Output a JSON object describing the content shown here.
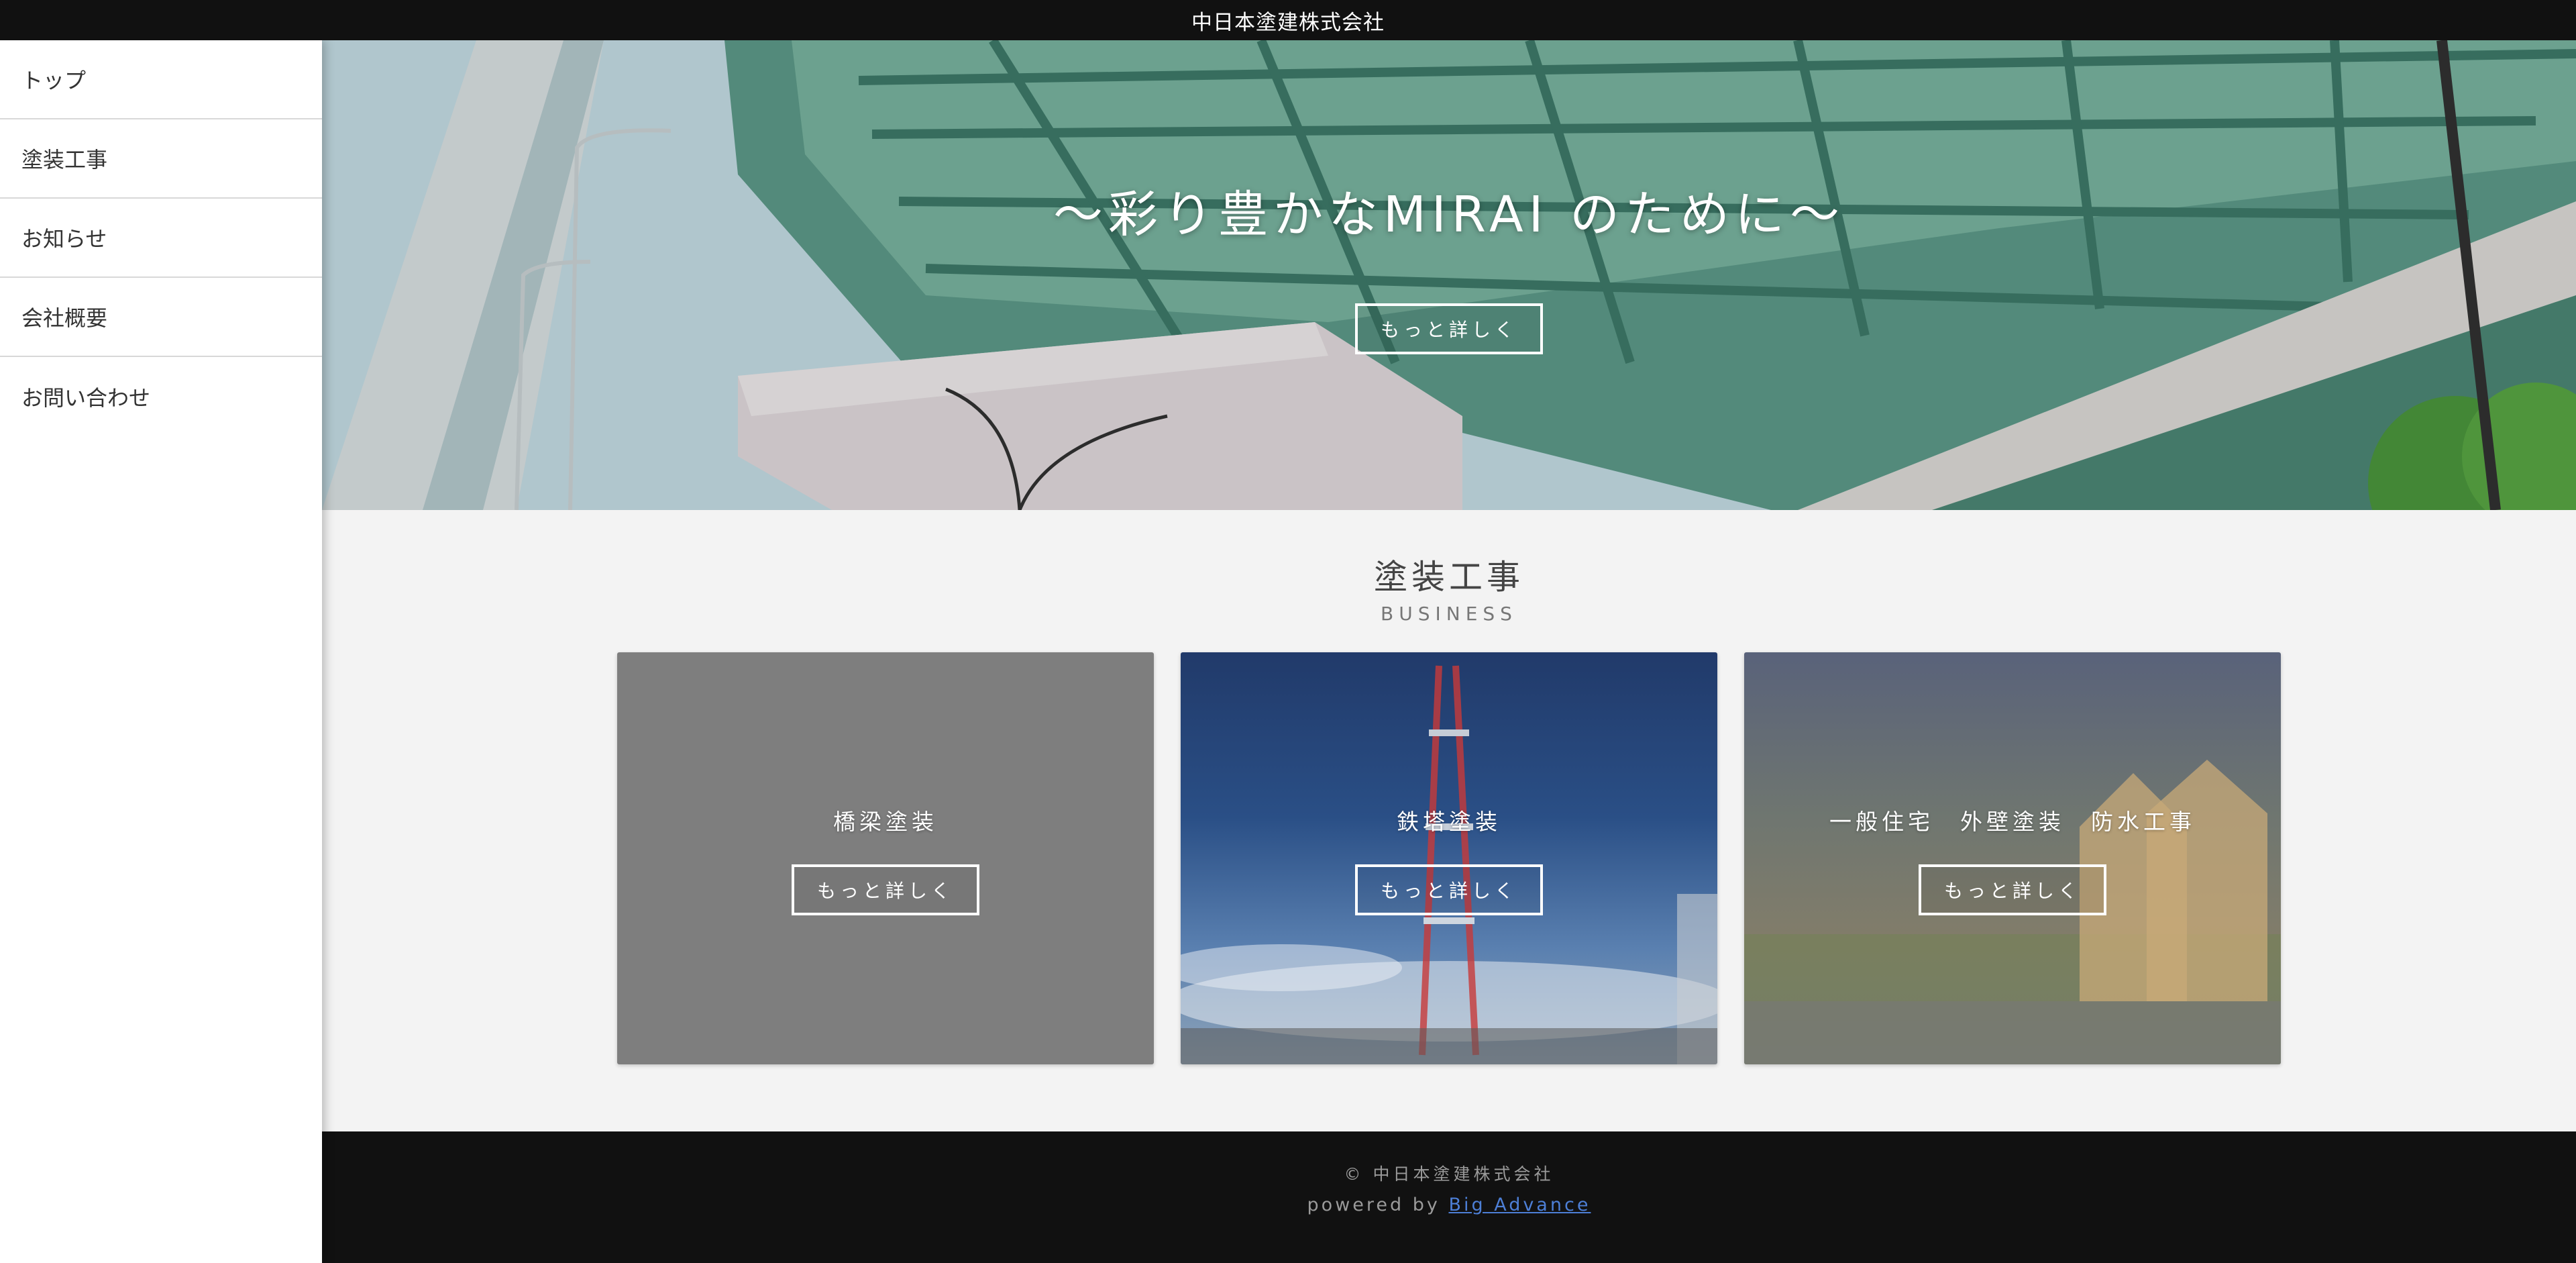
{
  "header": {
    "title": "中日本塗建株式会社"
  },
  "sidebar": {
    "items": [
      {
        "label": "トップ"
      },
      {
        "label": "塗装工事"
      },
      {
        "label": "お知らせ"
      },
      {
        "label": "会社概要"
      },
      {
        "label": "お問い合わせ"
      }
    ]
  },
  "hero": {
    "title": "〜彩り豊かなMIRAI のために〜",
    "button_label": "もっと詳しく"
  },
  "business": {
    "title": "塗装工事",
    "subtitle": "BUSINESS",
    "cards": [
      {
        "title": "橋梁塗装",
        "button_label": "もっと詳しく"
      },
      {
        "title": "鉄塔塗装",
        "button_label": "もっと詳しく"
      },
      {
        "title": "一般住宅　外壁塗装　防水工事",
        "button_label": "もっと詳しく"
      }
    ]
  },
  "footer": {
    "copyright": "© 中日本塗建株式会社",
    "powered_prefix": "powered by",
    "powered_link": "Big Advance"
  },
  "colors": {
    "topbar": "#111111",
    "footer": "#111111",
    "section_bg": "#f3f3f3",
    "link": "#4d7fd6"
  }
}
